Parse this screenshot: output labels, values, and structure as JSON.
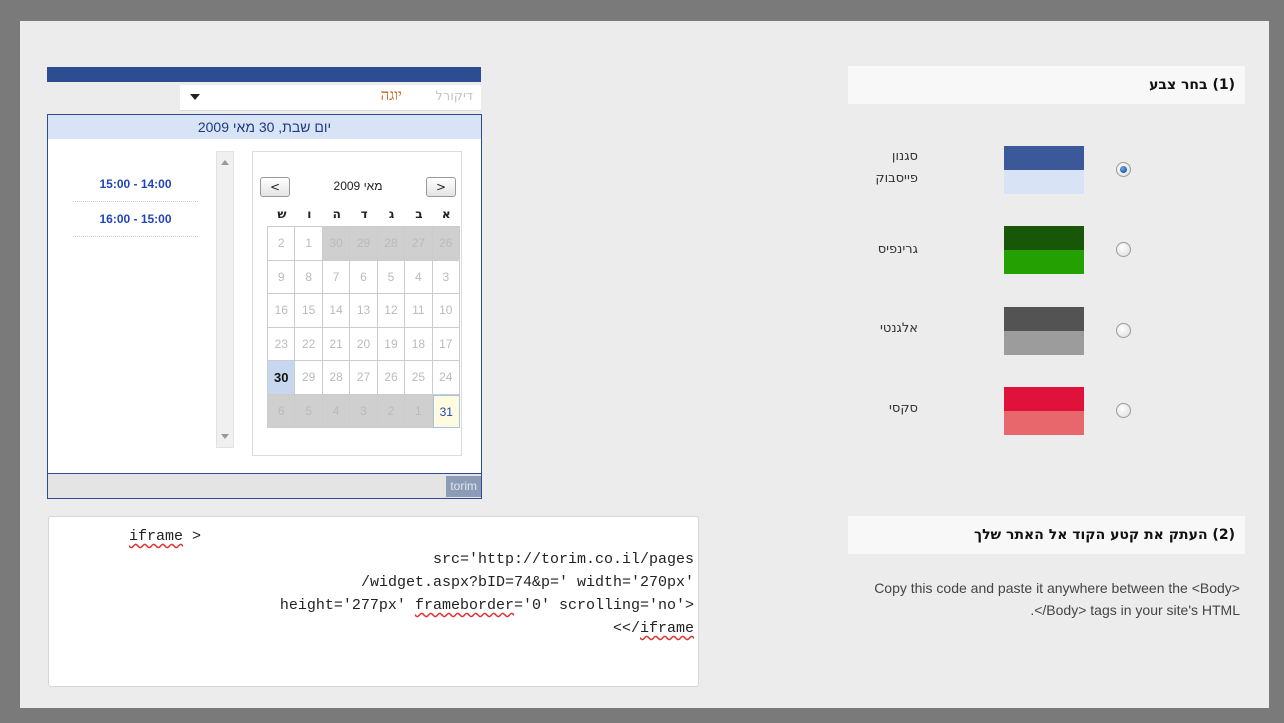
{
  "section1": {
    "title": "(1) בחר צבע"
  },
  "color_options": [
    {
      "label_line1": "סגנון",
      "label_line2": "פייסבוק",
      "top_color": "#3b5998",
      "bottom_color": "#d8e4f6",
      "checked": true
    },
    {
      "label_line1": "גרינפיס",
      "label_line2": "",
      "top_color": "#185708",
      "bottom_color": "#25a003",
      "checked": false
    },
    {
      "label_line1": "אלגנטי",
      "label_line2": "",
      "top_color": "#535353",
      "bottom_color": "#9c9c9c",
      "checked": false
    },
    {
      "label_line1": "סקסי",
      "label_line2": "",
      "top_color": "#e0113a",
      "bottom_color": "#e8676d",
      "checked": false
    }
  ],
  "section2": {
    "title": "(2) העתק את קטע הקוד אל האתר שלך",
    "instructions": "Copy this code and paste it anywhere between the <Body></Body> tags in your site's HTML."
  },
  "widget": {
    "category_selected": "יוגה",
    "subcategory": "דיקורל",
    "date_header": "יום שבת, 30 מאי 2009",
    "time_slots": [
      "15:00 - 14:00",
      "16:00 - 15:00"
    ],
    "calendar": {
      "month_label": "מאי 2009",
      "prev_button": "<",
      "next_button": ">",
      "weekday_headers": [
        "א",
        "ב",
        "ג",
        "ד",
        "ה",
        "ו",
        "ש"
      ],
      "weeks": [
        [
          "26",
          "27",
          "28",
          "29",
          "30",
          "1",
          "2"
        ],
        [
          "3",
          "4",
          "5",
          "6",
          "7",
          "8",
          "9"
        ],
        [
          "10",
          "11",
          "12",
          "13",
          "14",
          "15",
          "16"
        ],
        [
          "17",
          "18",
          "19",
          "20",
          "21",
          "22",
          "23"
        ],
        [
          "24",
          "25",
          "26",
          "27",
          "28",
          "29",
          "30"
        ],
        [
          "31",
          "1",
          "2",
          "3",
          "4",
          "5",
          "6"
        ]
      ]
    },
    "brand": "torim"
  },
  "code_snippet": {
    "line1_tag": "iframe",
    "line1_tail": " >",
    "line2": "src='http://torim.co.il/pages",
    "line3": "/widget.aspx?bID=74&p=' width='270px'",
    "line4_a": "height='277px' ",
    "line4_b": "frameborder",
    "line4_c": "='0' scrolling='no'>",
    "line5_a": "<</",
    "line5_b": "iframe"
  }
}
